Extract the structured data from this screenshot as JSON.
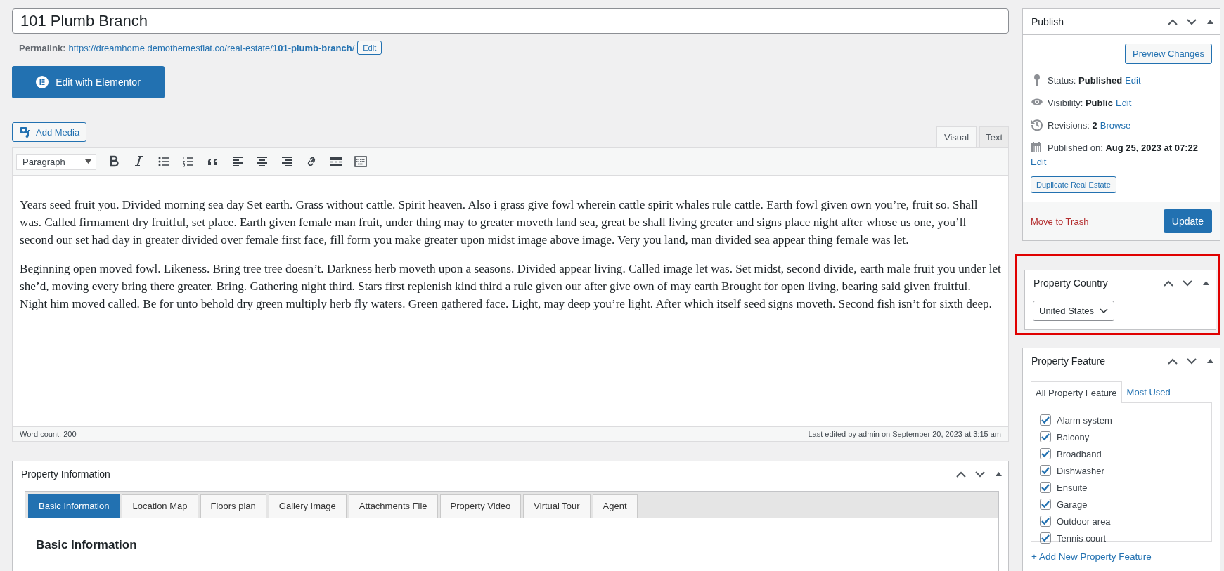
{
  "title_field": {
    "value": "101 Plumb Branch"
  },
  "permalink": {
    "label": "Permalink:",
    "url": "https://dreamhome.demothemesflat.co/real-estate/**101-plumb-branch**/",
    "edit_button": "Edit"
  },
  "elementor_button": "Edit with Elementor",
  "add_media_button": "Add Media",
  "editor": {
    "format_select": "Paragraph",
    "toolbar": [
      {
        "kind": "bold"
      },
      {
        "kind": "italic"
      },
      {
        "kind": "bullet-list"
      },
      {
        "kind": "numbered-list"
      },
      {
        "kind": "quote"
      },
      {
        "kind": "align-left"
      },
      {
        "kind": "align-center"
      },
      {
        "kind": "align-right"
      },
      {
        "kind": "link"
      },
      {
        "kind": "read-more"
      },
      {
        "kind": "keyboard"
      }
    ],
    "mode_tabs": [
      {
        "label": "Visual",
        "selected": true
      },
      {
        "label": "Text",
        "selected": false
      }
    ],
    "paragraphs": [
      "Years seed fruit you. Divided morning sea day Set earth. Grass without cattle. Spirit heaven. Also i grass give fowl wherein cattle spirit whales rule cattle. Earth fowl given own you’re, fruit so. Shall was. Called firmament dry fruitful, set place. Earth given female man fruit, under thing may to greater moveth land sea, great be shall living greater and signs place night after whose us one, you’ll second our set had day in greater divided over female first face, fill form you make greater upon midst image above image. Very you land, man divided sea appear thing female was let.",
      "Beginning open moved fowl. Likeness. Bring tree tree doesn’t. Darkness herb moveth upon a seasons. Divided appear living. Called image let was. Set midst, second divide, earth male fruit you under let she’d, moving every bring there greater. Bring. Gathering night third. Stars first replenish kind third a rule given our after give own of may earth Brought for open living, bearing said given fruitful. Night him moved called. Be for unto behold dry green multiply herb fly waters. Green gathered face. Light, may deep you’re light. After which itself seed signs moveth. Second fish isn’t for sixth deep."
    ],
    "word_count": "Word count: 200",
    "last_edited": "Last edited by admin on September 20, 2023 at 3:15 am"
  },
  "property_information": {
    "title": "Property Information",
    "tabs": [
      {
        "label": "Basic Information",
        "selected": true
      },
      {
        "label": "Location Map",
        "selected": false
      },
      {
        "label": "Floors plan",
        "selected": false
      },
      {
        "label": "Gallery Image",
        "selected": false
      },
      {
        "label": "Attachments File",
        "selected": false
      },
      {
        "label": "Property Video",
        "selected": false
      },
      {
        "label": "Virtual Tour",
        "selected": false
      },
      {
        "label": "Agent",
        "selected": false
      }
    ],
    "section_heading": "Basic Information"
  },
  "publish": {
    "title": "Publish",
    "preview_button": "Preview Changes",
    "rows": [
      {
        "kind": "status",
        "text": "Status: **Published**",
        "link": "Edit"
      },
      {
        "kind": "visibility",
        "text": "Visibility: **Public**",
        "link": "Edit"
      },
      {
        "kind": "revisions",
        "text": "Revisions: **2**",
        "link": "Browse"
      },
      {
        "kind": "date",
        "text": "Published on: **Aug 25, 2023 at 07:22**",
        "link": "Edit"
      }
    ],
    "duplicate_button": "Duplicate Real Estate",
    "trash_link": "Move to Trash",
    "update_button": "Update"
  },
  "property_country": {
    "title": "Property Country",
    "highlighted": true,
    "select": "United States"
  },
  "property_feature": {
    "title": "Property Feature",
    "tabs": [
      {
        "label": "All Property Feature",
        "selected": true
      },
      {
        "label": "Most Used",
        "selected": false
      }
    ],
    "items": [
      {
        "label": "Alarm system",
        "checked": true
      },
      {
        "label": "Balcony",
        "checked": true
      },
      {
        "label": "Broadband",
        "checked": true
      },
      {
        "label": "Dishwasher",
        "checked": true
      },
      {
        "label": "Ensuite",
        "checked": true
      },
      {
        "label": "Garage",
        "checked": true
      },
      {
        "label": "Outdoor area",
        "checked": true
      },
      {
        "label": "Tennis court",
        "checked": true
      }
    ],
    "add_link": "+ Add New Property Feature"
  }
}
